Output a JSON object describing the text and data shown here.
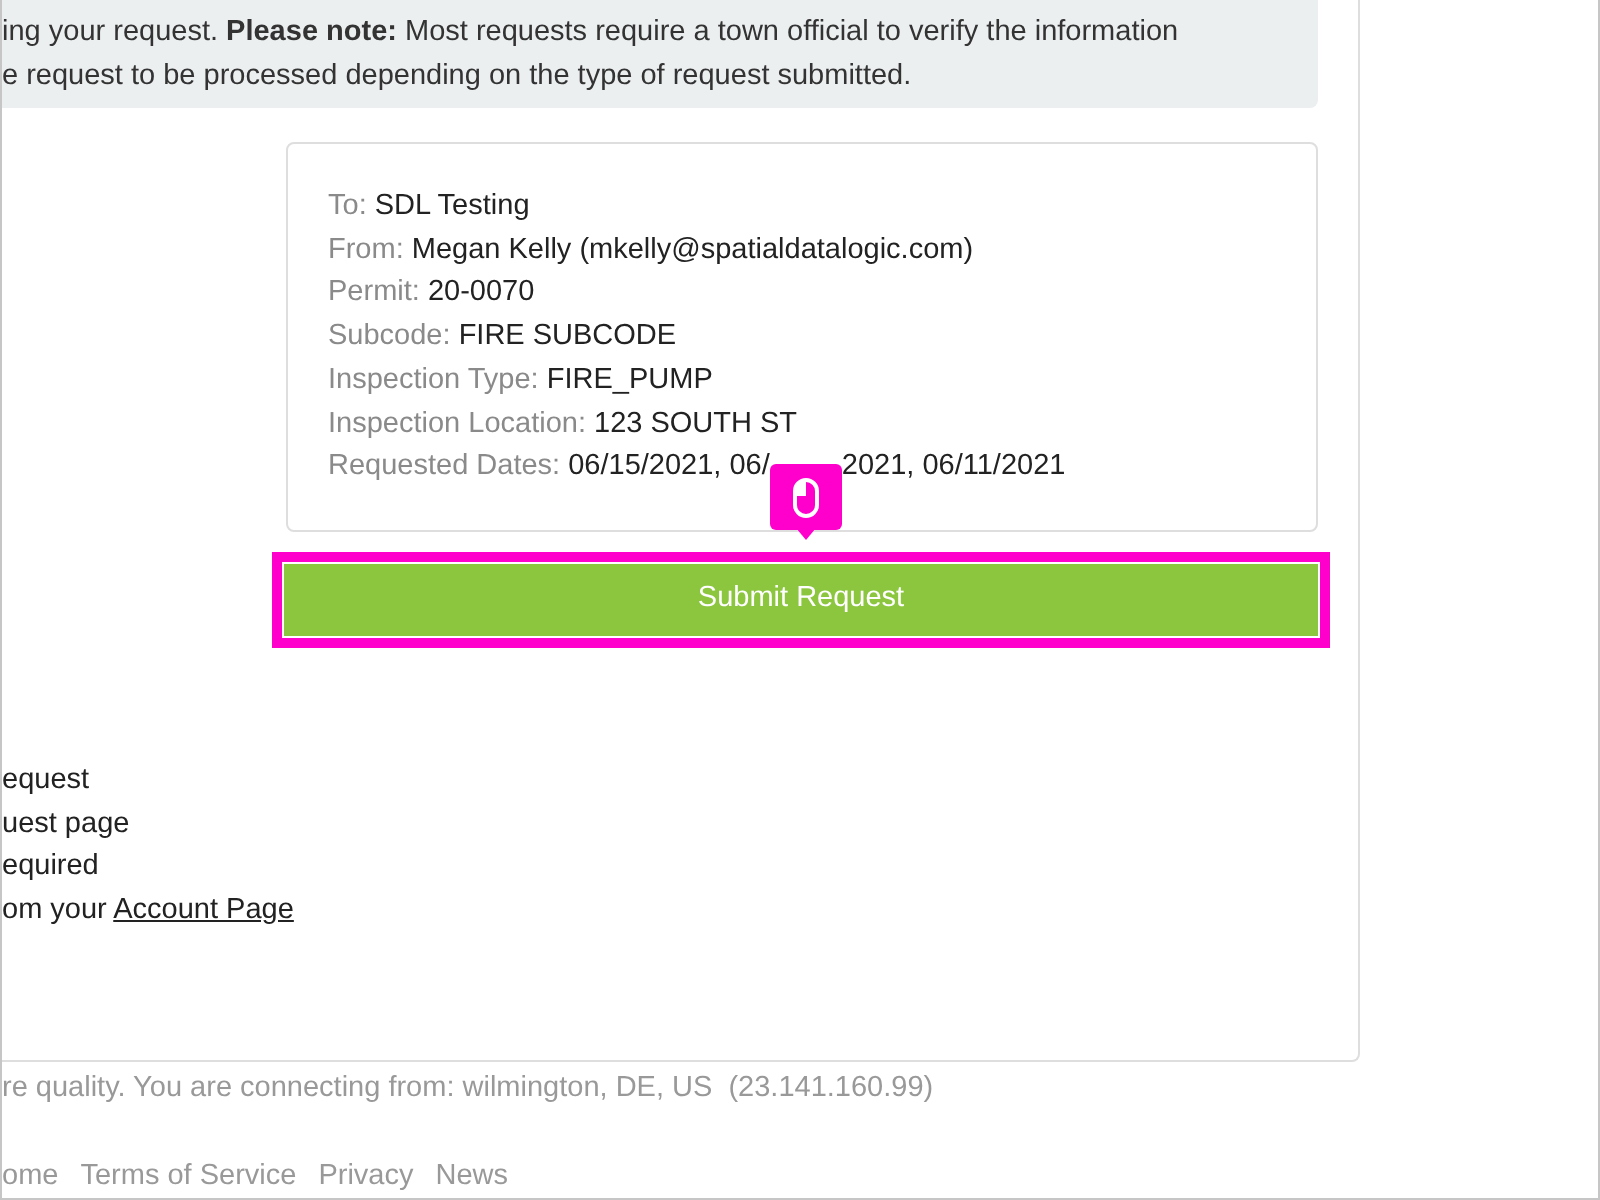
{
  "notice": {
    "lines": [
      "ing your request. **Please note:** Most requests require a town official to verify the information",
      "e request to be processed depending on the type of request submitted."
    ]
  },
  "summary": {
    "fields": [
      {
        "label": "To:",
        "value": "SDL Testing"
      },
      {
        "label": "From:",
        "value": "Megan Kelly (mkelly@spatialdatalogic.com)"
      },
      {
        "label": "Permit:",
        "value": "20-0070"
      },
      {
        "label": "Subcode:",
        "value": "FIRE SUBCODE"
      },
      {
        "label": "Inspection Type:",
        "value": "FIRE_PUMP"
      },
      {
        "label": "Inspection Location:",
        "value": "123 SOUTH ST"
      },
      {
        "label": "Requested Dates:",
        "value": "06/15/2021, 06/",
        "value_after": "2021, 06/11/2021"
      }
    ]
  },
  "submit_button": {
    "label": "Submit Request",
    "highlighted": true
  },
  "steps": [
    {
      "text": "equest"
    },
    {
      "text": "uest page"
    },
    {
      "text": "equired"
    },
    {
      "text": "om your",
      "link": "Account Page"
    }
  ],
  "location_note": "re quality. You are connecting from: wilmington, DE, US  (23.141.160.99)",
  "footer_links": [
    "ome",
    "Terms of Service",
    "Privacy",
    "News"
  ]
}
